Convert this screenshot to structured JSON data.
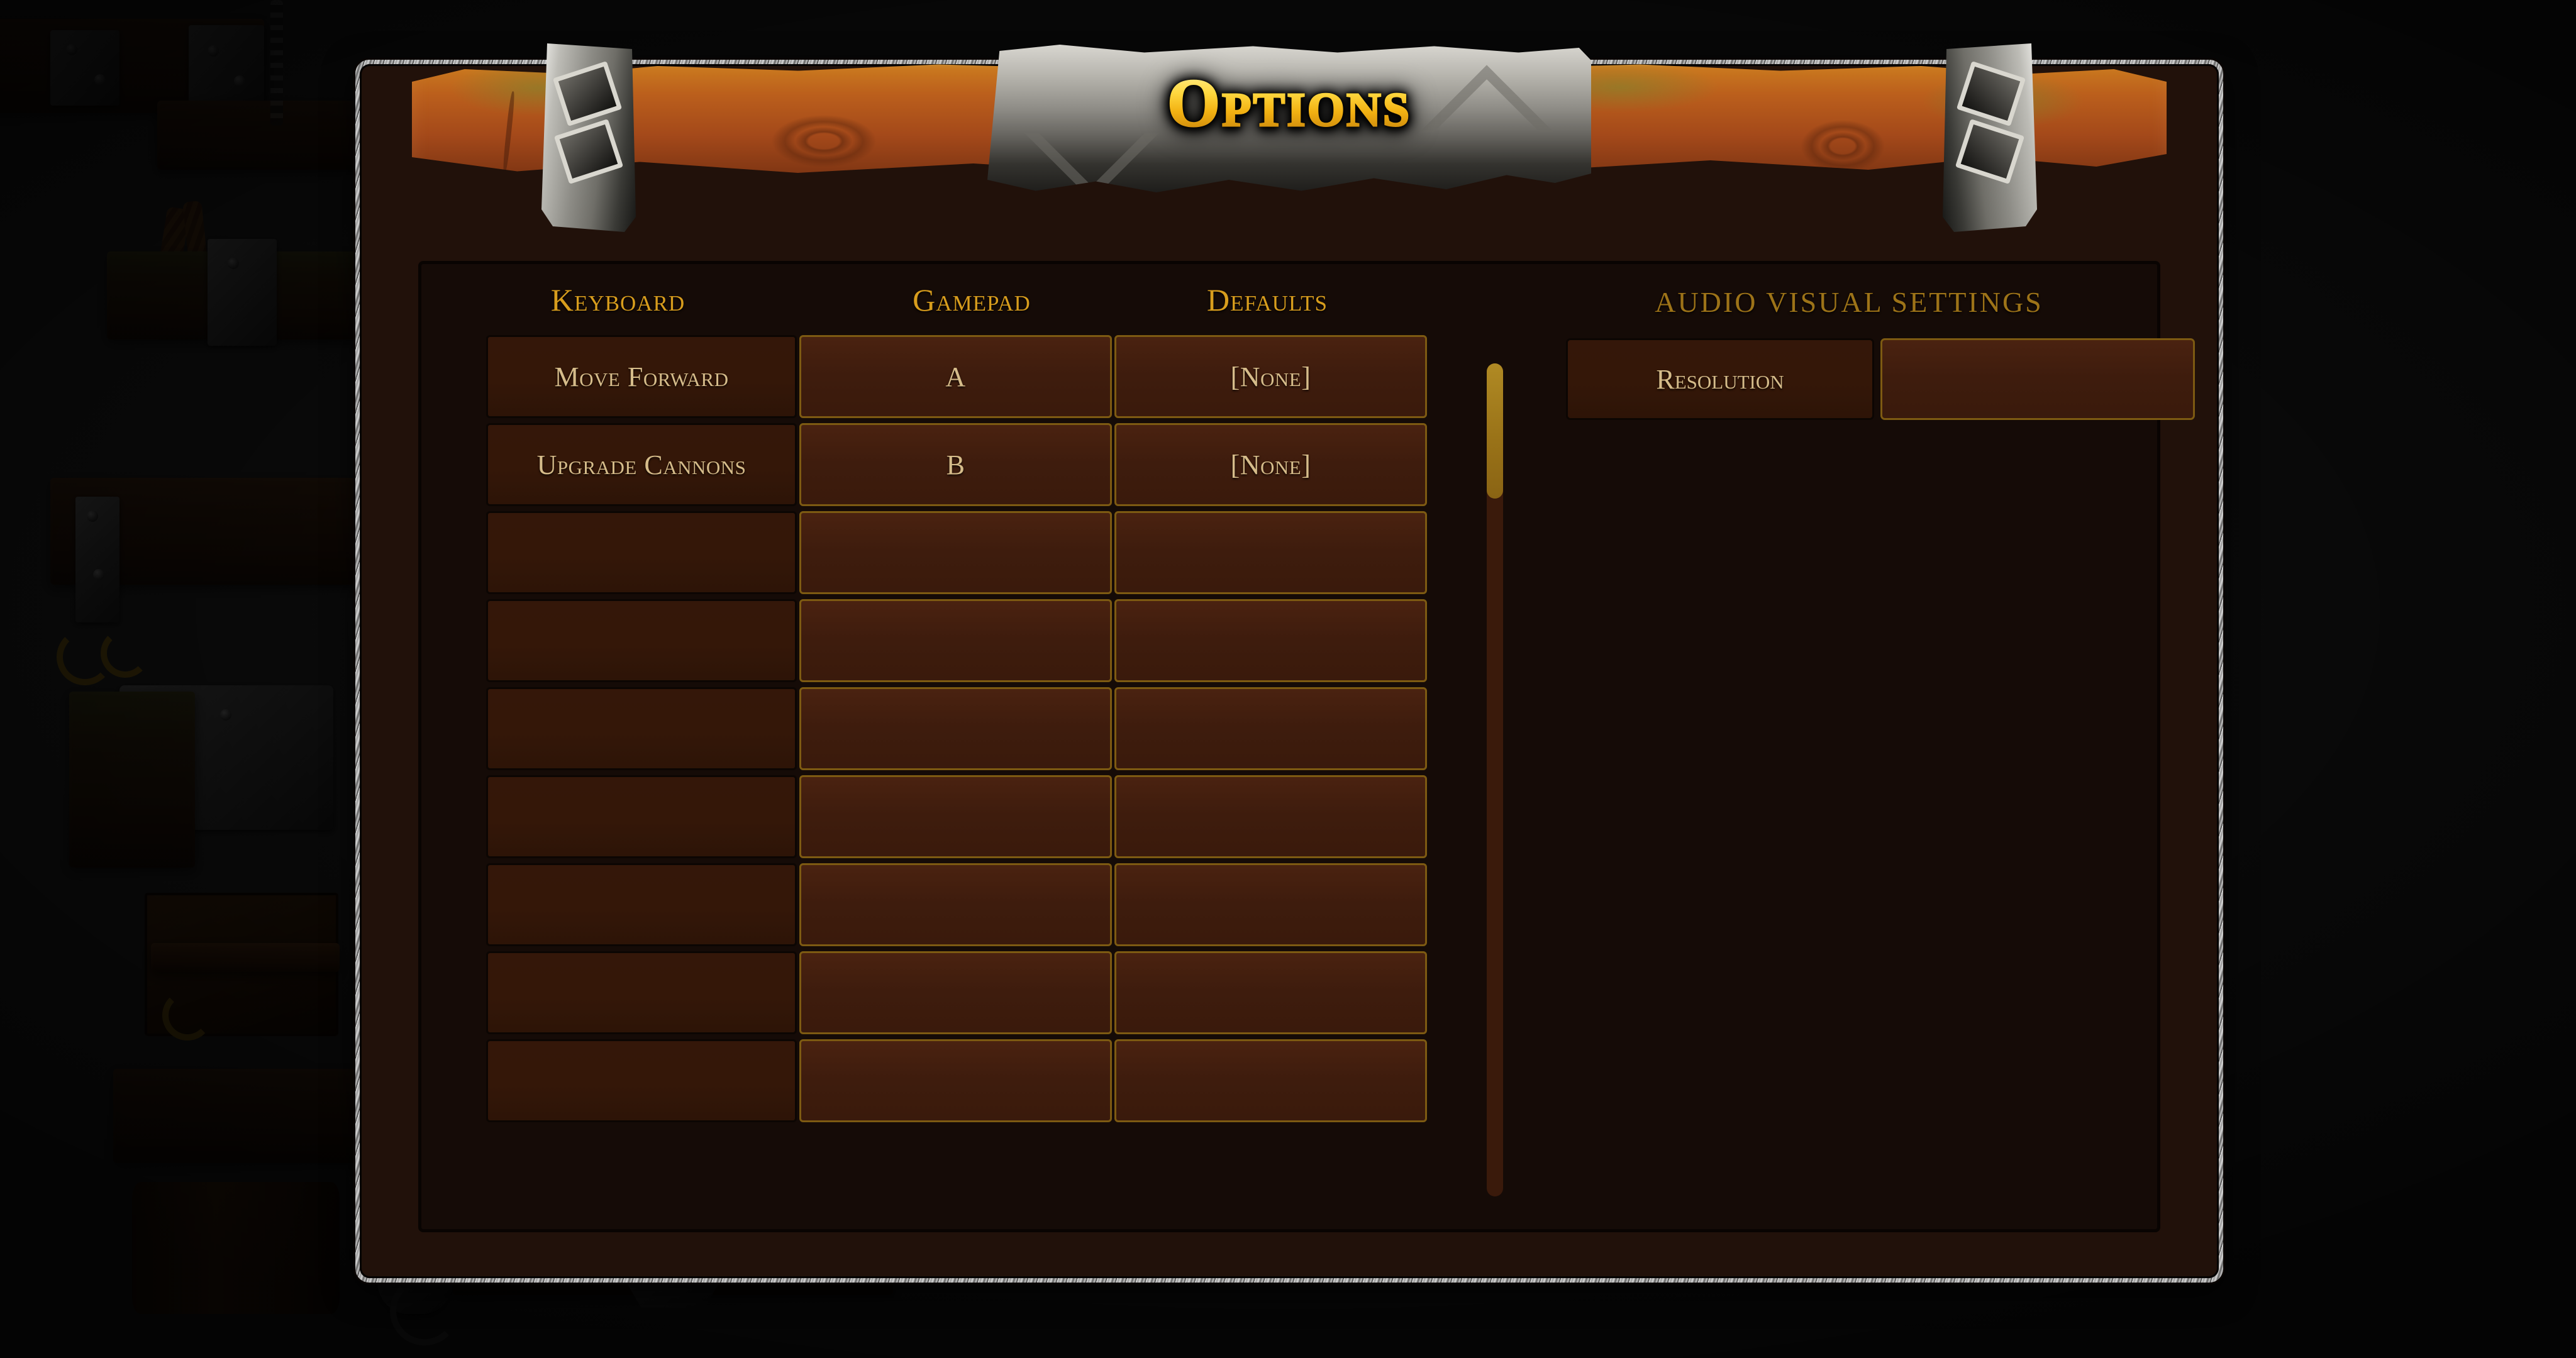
{
  "window": {
    "title": "Options"
  },
  "bindings": {
    "column_headers": [
      "Keyboard",
      "Gamepad",
      "Defaults"
    ],
    "rows": [
      {
        "action": "Move Forward",
        "gamepad": "A",
        "defaults": "[None]"
      },
      {
        "action": "Upgrade Cannons",
        "gamepad": "B",
        "defaults": "[None]"
      },
      {
        "action": "",
        "gamepad": "",
        "defaults": ""
      },
      {
        "action": "",
        "gamepad": "",
        "defaults": ""
      },
      {
        "action": "",
        "gamepad": "",
        "defaults": ""
      },
      {
        "action": "",
        "gamepad": "",
        "defaults": ""
      },
      {
        "action": "",
        "gamepad": "",
        "defaults": ""
      },
      {
        "action": "",
        "gamepad": "",
        "defaults": ""
      },
      {
        "action": "",
        "gamepad": "",
        "defaults": ""
      }
    ],
    "scrollbar": {
      "name": "bindings-scrollbar"
    }
  },
  "audio_visual": {
    "title": "AUDIO VISUAL SETTINGS",
    "rows": [
      {
        "label": "Resolution",
        "value": ""
      }
    ]
  },
  "colors": {
    "title_gold": "#ffd83f",
    "header_gold": "#d89d1d",
    "av_header_gold": "#9d7318",
    "cell_text": "#d6bc8a",
    "cell_fill": "#3e1c0d",
    "cell_border_gold": "#7d5a12",
    "cell_border_dark": "#0c0603",
    "panel_bg": "#150b07",
    "window_bg": "#21110a",
    "scroll_thumb": "#9a7318",
    "scroll_track": "#3a1a0b"
  }
}
